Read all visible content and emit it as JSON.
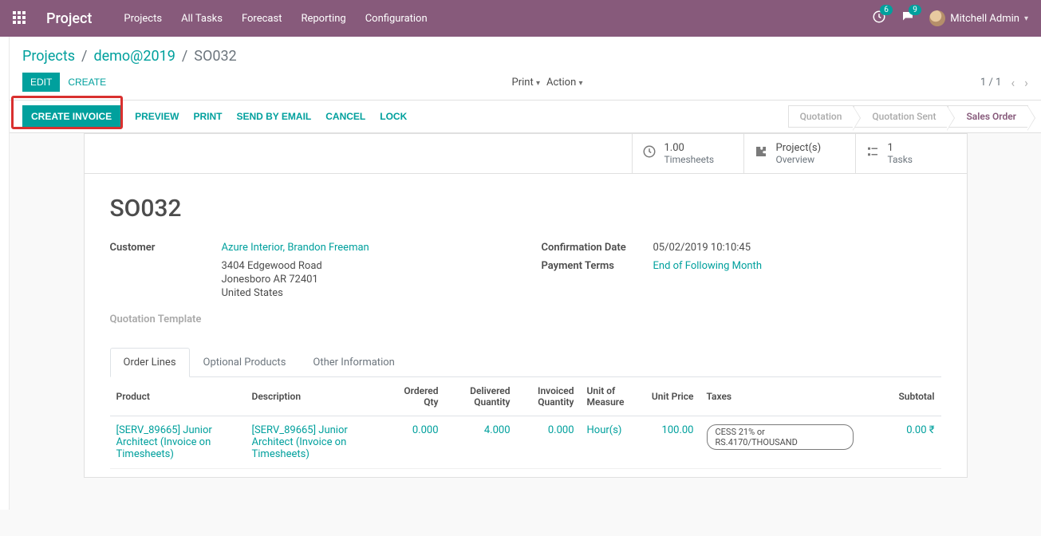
{
  "topbar": {
    "brand": "Project",
    "nav": [
      "Projects",
      "All Tasks",
      "Forecast",
      "Reporting",
      "Configuration"
    ],
    "clock_badge": "6",
    "chat_badge": "9",
    "user": "Mitchell Admin"
  },
  "breadcrumb": {
    "level1": "Projects",
    "level2": "demo@2019",
    "current": "SO032"
  },
  "control": {
    "edit": "Edit",
    "create": "Create",
    "print": "Print",
    "action": "Action",
    "pager": "1 / 1"
  },
  "statusbar": {
    "create_invoice": "Create Invoice",
    "preview": "Preview",
    "print": "Print",
    "send_email": "Send by Email",
    "cancel": "Cancel",
    "lock": "Lock",
    "steps": [
      "Quotation",
      "Quotation Sent",
      "Sales Order"
    ]
  },
  "stat_buttons": {
    "timesheets_val": "1.00",
    "timesheets_lbl": "Timesheets",
    "projects_val": "Project(s)",
    "projects_lbl": "Overview",
    "tasks_val": "1",
    "tasks_lbl": "Tasks"
  },
  "form": {
    "title": "SO032",
    "customer_label": "Customer",
    "customer_name": "Azure Interior, Brandon Freeman",
    "addr1": "3404 Edgewood Road",
    "addr2": "Jonesboro AR 72401",
    "addr3": "United States",
    "qt_label": "Quotation Template",
    "conf_date_label": "Confirmation Date",
    "conf_date_val": "05/02/2019 10:10:45",
    "pay_terms_label": "Payment Terms",
    "pay_terms_val": "End of Following Month"
  },
  "tabs": {
    "order_lines": "Order Lines",
    "optional": "Optional Products",
    "other": "Other Information"
  },
  "table": {
    "headers": {
      "product": "Product",
      "description": "Description",
      "ordered_qty": "Ordered Qty",
      "delivered_qty": "Delivered Quantity",
      "invoiced_qty": "Invoiced Quantity",
      "uom": "Unit of Measure",
      "unit_price": "Unit Price",
      "taxes": "Taxes",
      "subtotal": "Subtotal"
    },
    "row": {
      "product": "[SERV_89665] Junior Architect (Invoice on Timesheets)",
      "description": "[SERV_89665] Junior Architect (Invoice on Timesheets)",
      "ordered": "0.000",
      "delivered": "4.000",
      "invoiced": "0.000",
      "uom": "Hour(s)",
      "price": "100.00",
      "tax": "CESS 21% or RS.4170/THOUSAND",
      "subtotal": "0.00 ₹"
    }
  }
}
